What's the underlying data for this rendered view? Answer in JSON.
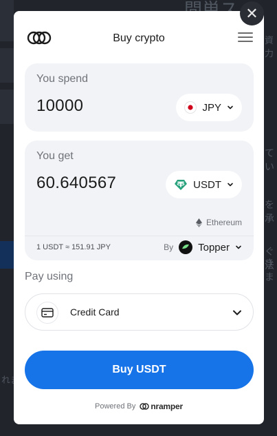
{
  "background": {
    "jp_texts": [
      "間単ス",
      "資力",
      "てい",
      "を承",
      "ぐ法",
      "きま",
      "れま"
    ]
  },
  "modal": {
    "close_glyph": "✕",
    "header": {
      "title": "Buy crypto"
    },
    "spend": {
      "label": "You spend",
      "amount": "10000",
      "currency": "JPY"
    },
    "get": {
      "label": "You get",
      "amount": "60.640567",
      "currency": "USDT",
      "network": "Ethereum",
      "rate": "1 USDT ≈ 151.91 JPY",
      "provider_prefix": "By",
      "provider": "Topper"
    },
    "payment": {
      "label": "Pay using",
      "method": "Credit Card"
    },
    "buy_button": "Buy USDT",
    "footer": {
      "powered_by": "Powered By",
      "brand": "nramper"
    }
  },
  "colors": {
    "accent": "#1674e8",
    "tether": "#26a17b",
    "panel": "#f1f3f6"
  }
}
